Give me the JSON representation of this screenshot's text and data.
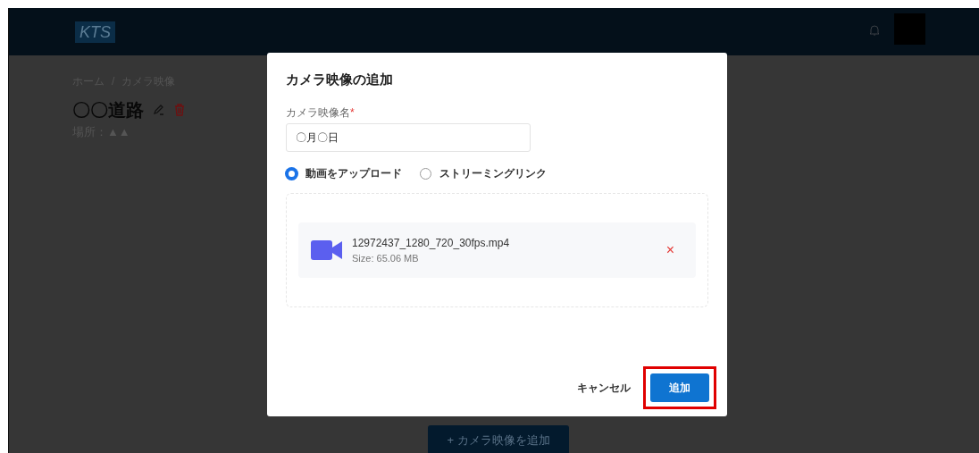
{
  "header": {
    "logo": "KTS"
  },
  "breadcrumb": [
    "ホーム",
    "/",
    "カメラ映像"
  ],
  "page_title": "〇〇道路",
  "location": "場所：▲▲",
  "add_camera_button": "+ カメラ映像を追加",
  "dialog": {
    "title": "カメラ映像の追加",
    "name_field": {
      "label": "カメラ映像名",
      "required_mark": "*",
      "value": "〇月〇日"
    },
    "source_options": [
      {
        "label": "動画をアップロード",
        "selected": true
      },
      {
        "label": "ストリーミングリンク",
        "selected": false
      }
    ],
    "file": {
      "name": "12972437_1280_720_30fps.mp4",
      "size": "Size: 65.06 MB",
      "remove": "×"
    },
    "buttons": [
      {
        "kind": "text",
        "label": "キャンセル",
        "highlighted": false
      },
      {
        "kind": "primary",
        "label": "追加",
        "highlighted": true
      }
    ]
  }
}
